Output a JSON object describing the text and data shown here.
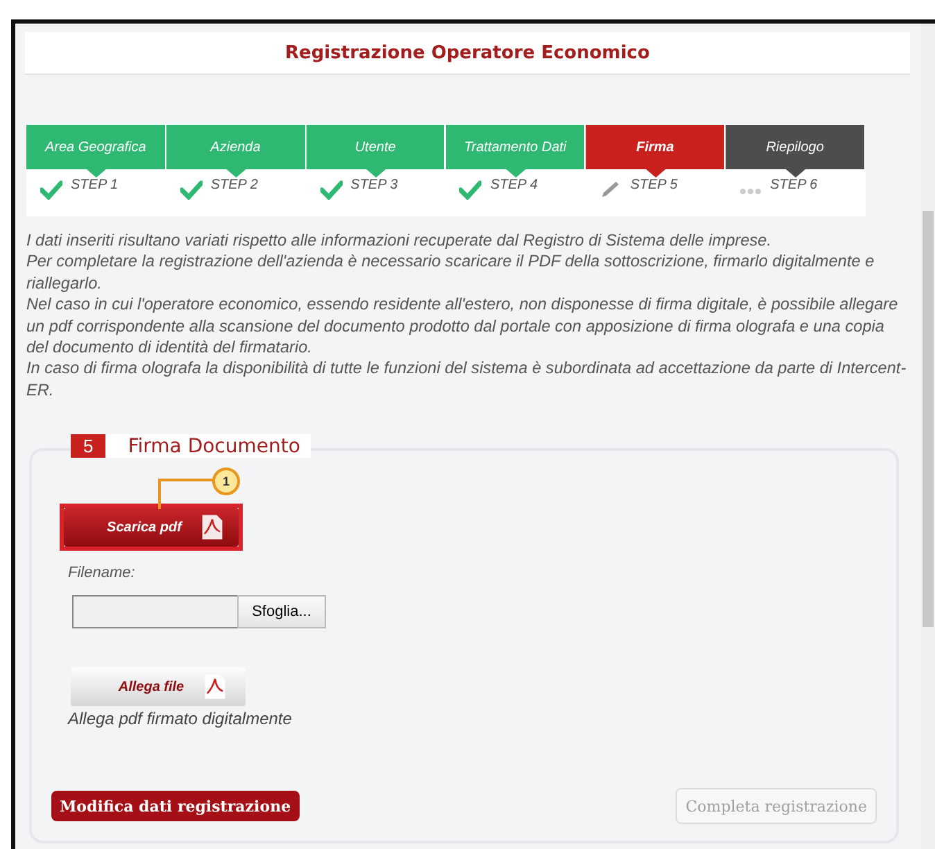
{
  "title": "Registrazione Operatore Economico",
  "steps": [
    {
      "label": "Area Geografica",
      "step": "STEP 1",
      "kind": "done"
    },
    {
      "label": "Azienda",
      "step": "STEP 2",
      "kind": "done"
    },
    {
      "label": "Utente",
      "step": "STEP 3",
      "kind": "done"
    },
    {
      "label": "Trattamento Dati",
      "step": "STEP 4",
      "kind": "done"
    },
    {
      "label": "Firma",
      "step": "STEP 5",
      "kind": "current"
    },
    {
      "label": "Riepilogo",
      "step": "STEP 6",
      "kind": "pending"
    }
  ],
  "info": [
    "I dati inseriti risultano variati rispetto alle informazioni recuperate dal Registro di Sistema delle imprese.",
    "Per completare la registrazione dell'azienda è necessario scaricare il PDF della sottoscrizione, firmarlo digitalmente e riallegarlo.",
    "Nel caso in cui l'operatore economico, essendo residente all'estero, non disponesse di firma digitale, è possibile allegare un pdf corrispondente alla scansione del documento prodotto dal portale con apposizione di firma olografa e una copia del documento di identità del firmatario.",
    "In caso di firma olografa la disponibilità di tutte le funzioni del sistema è subordinata ad accettazione da parte di Intercent-ER."
  ],
  "section": {
    "number": "5",
    "title": "Firma Documento",
    "callout": "1",
    "download_button": "Scarica pdf",
    "filename_label": "Filename:",
    "browse_button": "Sfoglia...",
    "attach_button": "Allega file",
    "attach_hint": "Allega pdf firmato digitalmente"
  },
  "actions": [
    {
      "label": "Modifica dati registrazione",
      "disabled": false
    },
    {
      "label": "Completa registrazione",
      "disabled": true
    }
  ]
}
